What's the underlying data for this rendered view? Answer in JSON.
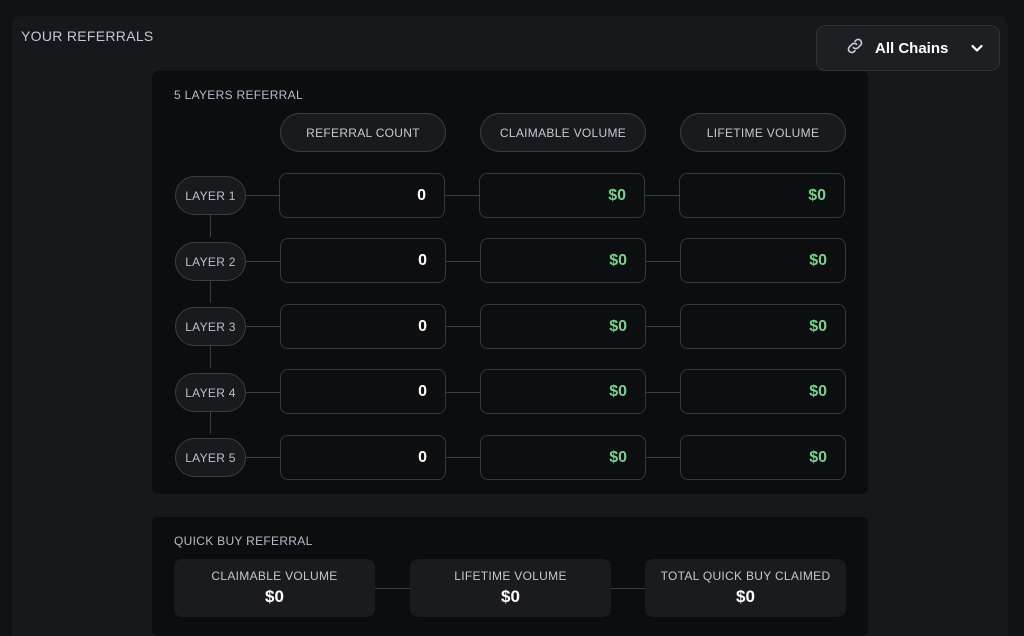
{
  "panel": {
    "title": "YOUR REFERRALS"
  },
  "chain_selector": {
    "label": "All Chains",
    "icon": "link-icon",
    "chevron": "chevron-down-icon"
  },
  "layers_card": {
    "title": "5 LAYERS REFERRAL",
    "columns": [
      "REFERRAL COUNT",
      "CLAIMABLE VOLUME",
      "LIFETIME VOLUME"
    ],
    "rows": [
      {
        "layer": "LAYER 1",
        "count": "0",
        "claimable": "$0",
        "lifetime": "$0"
      },
      {
        "layer": "LAYER 2",
        "count": "0",
        "claimable": "$0",
        "lifetime": "$0"
      },
      {
        "layer": "LAYER 3",
        "count": "0",
        "claimable": "$0",
        "lifetime": "$0"
      },
      {
        "layer": "LAYER 4",
        "count": "0",
        "claimable": "$0",
        "lifetime": "$0"
      },
      {
        "layer": "LAYER 5",
        "count": "0",
        "claimable": "$0",
        "lifetime": "$0"
      }
    ]
  },
  "quick_buy": {
    "title": "QUICK BUY REFERRAL",
    "items": [
      {
        "label": "CLAIMABLE VOLUME",
        "value": "$0"
      },
      {
        "label": "LIFETIME VOLUME",
        "value": "$0"
      },
      {
        "label": "TOTAL QUICK BUY CLAIMED",
        "value": "$0"
      }
    ]
  },
  "colors": {
    "money": "#7ccf8c",
    "background": "#101113",
    "panel": "#17181b",
    "card": "#0c0d0f"
  }
}
